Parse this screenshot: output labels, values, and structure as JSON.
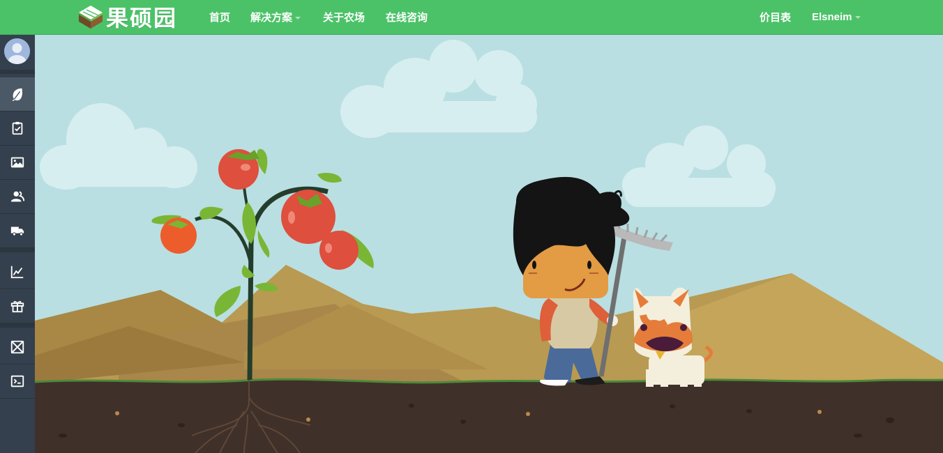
{
  "app": {
    "logo_text": "果硕园"
  },
  "nav": {
    "home": "首页",
    "solutions": "解决方案",
    "about": "关于农场",
    "consult": "在线咨询",
    "price_list": "价目表",
    "user": "Elsneim"
  },
  "sidebar": {
    "items": [
      {
        "icon": "leaf-icon",
        "active": true
      },
      {
        "icon": "clipboard-check-icon",
        "active": false
      },
      {
        "icon": "image-icon",
        "active": false
      },
      {
        "icon": "users-icon",
        "active": false
      },
      {
        "icon": "truck-icon",
        "active": false
      },
      {
        "icon": "line-chart-icon",
        "active": false
      },
      {
        "icon": "gift-icon",
        "active": false
      },
      {
        "icon": "mail-icon",
        "active": false
      },
      {
        "icon": "terminal-icon",
        "active": false
      }
    ]
  },
  "colors": {
    "header": "#4bc268",
    "sidebar": "#34404d",
    "sky": "#b9dfe2",
    "soil": "#40302a",
    "mountain": "#b89a52"
  }
}
